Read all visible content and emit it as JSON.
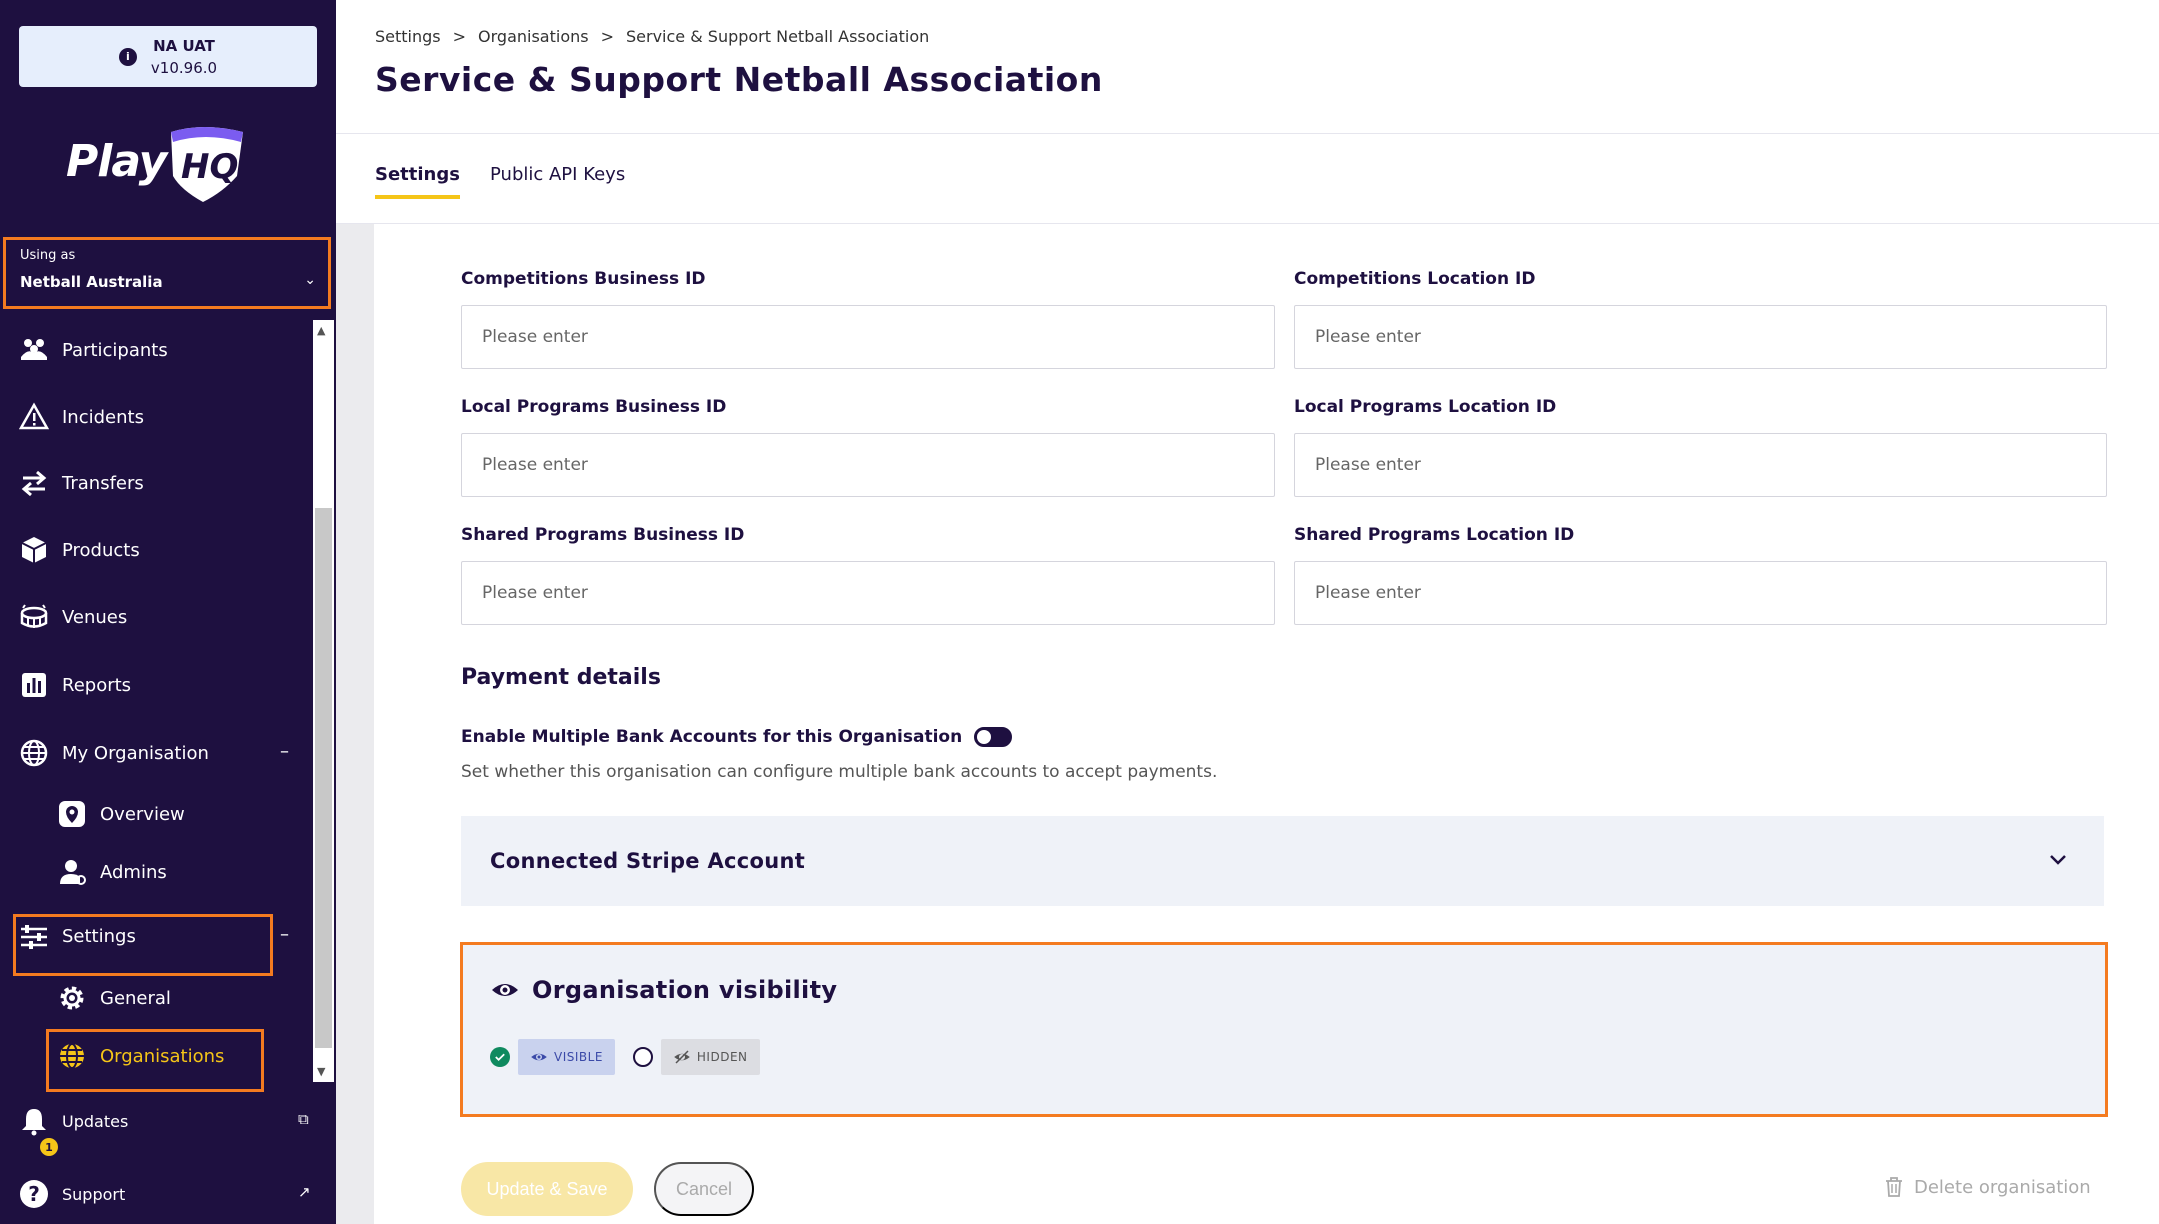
{
  "env": {
    "name": "NA UAT",
    "version": "v10.96.0",
    "info_icon": "i"
  },
  "brand": {
    "logo_text": "Play",
    "logo_badge": "HQ"
  },
  "using_as": {
    "label": "Using as",
    "value": "Netball Australia"
  },
  "nav": {
    "participants": "Participants",
    "incidents": "Incidents",
    "transfers": "Transfers",
    "products": "Products",
    "venues": "Venues",
    "reports": "Reports",
    "my_organisation": "My Organisation",
    "overview": "Overview",
    "admins": "Admins",
    "settings": "Settings",
    "general": "General",
    "organisations": "Organisations",
    "updates": "Updates",
    "updates_count": "1",
    "support": "Support",
    "collapse": "–"
  },
  "header": {
    "breadcrumb": [
      "Settings",
      ">",
      "Organisations",
      ">",
      "Service & Support Netball Association"
    ],
    "title": "Service & Support Netball Association"
  },
  "tabs": {
    "settings": "Settings",
    "api_keys": "Public API Keys"
  },
  "form": {
    "placeholder": "Please enter",
    "competitions_business_id": "Competitions Business ID",
    "competitions_location_id": "Competitions Location ID",
    "local_programs_business_id": "Local Programs Business ID",
    "local_programs_location_id": "Local Programs Location ID",
    "shared_programs_business_id": "Shared Programs Business ID",
    "shared_programs_location_id": "Shared Programs Location ID"
  },
  "payment": {
    "title": "Payment details",
    "toggle_label": "Enable Multiple Bank Accounts for this Organisation",
    "toggle_on": false,
    "help": "Set whether this organisation can configure multiple bank accounts to accept payments.",
    "stripe_title": "Connected Stripe Account"
  },
  "visibility": {
    "title": "Organisation visibility",
    "visible": "VISIBLE",
    "hidden": "HIDDEN",
    "selected": "visible"
  },
  "actions": {
    "save": "Update & Save",
    "cancel": "Cancel",
    "delete": "Delete organisation"
  },
  "colors": {
    "sidebar": "#1e1040",
    "accent": "#f5c518",
    "highlight": "#f47b20",
    "success": "#0f8a5f"
  }
}
